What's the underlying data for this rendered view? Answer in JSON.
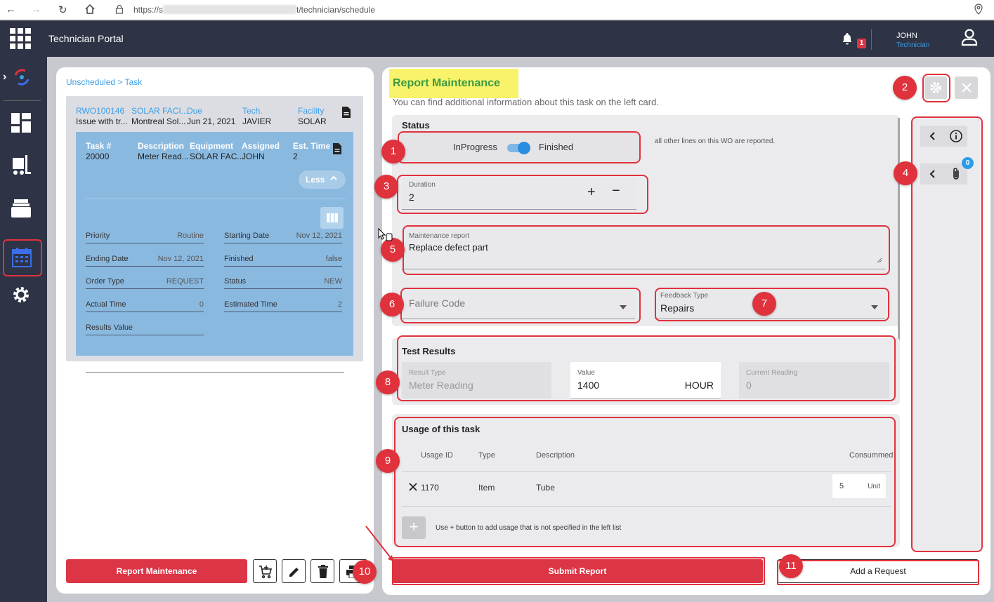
{
  "browser": {
    "url_prefix": "https://s",
    "url_suffix": "t/technician/schedule"
  },
  "app": {
    "title": "Technician Portal",
    "notification_count": "1",
    "user_name": "JOHN",
    "user_role": "Technician"
  },
  "left_card": {
    "breadcrumb": "Unscheduled > Task",
    "wo_headers": [
      "RWO100146",
      "SOLAR FACI...",
      "Due",
      "Tech.",
      "Facility"
    ],
    "wo_values": [
      "Issue with tr...",
      "Montreal Sol...",
      "Jun 21, 2021",
      "JAVIER",
      "SOLAR"
    ],
    "task_headers": [
      "Task #",
      "Description",
      "Equipment",
      "Assigned",
      "Est. Time"
    ],
    "task_values": [
      "20000",
      "Meter Read...",
      "SOLAR FAC...",
      "JOHN",
      "2"
    ],
    "less_label": "Less",
    "details_left": [
      {
        "label": "Priority",
        "value": "Routine"
      },
      {
        "label": "Ending Date",
        "value": "Nov 12, 2021"
      },
      {
        "label": "Order Type",
        "value": "REQUEST"
      },
      {
        "label": "Actual Time",
        "value": "0"
      },
      {
        "label": "Results Value",
        "value": ""
      }
    ],
    "details_right": [
      {
        "label": "Starting Date",
        "value": "Nov 12, 2021"
      },
      {
        "label": "Finished",
        "value": "false"
      },
      {
        "label": "Status",
        "value": "NEW"
      },
      {
        "label": "Estimated Time",
        "value": "2"
      }
    ],
    "report_button": "Report Maintenance"
  },
  "right_card": {
    "title": "Report Maintenance",
    "subtitle": "You can find additional information about this task on the left card.",
    "status_title": "Status",
    "toggle_left": "InProgress",
    "toggle_right": "Finished",
    "status_note": "all other lines on this WO are reported.",
    "duration_label": "Duration",
    "duration_value": "2",
    "maint_report_label": "Maintenance report",
    "maint_report_value": "Replace defect part",
    "failure_code_placeholder": "Failure Code",
    "feedback_type_label": "Feedback Type",
    "feedback_type_value": "Repairs",
    "test_results_title": "Test Results",
    "result_type_label": "Result Type",
    "result_type_value": "Meter Reading",
    "value_label": "Value",
    "value_value": "1400",
    "value_unit": "HOUR",
    "current_reading_label": "Current Reading",
    "current_reading_value": "0",
    "usage_title": "Usage of this task",
    "usage_headers": [
      "Usage ID",
      "Type",
      "Description",
      "Consummed"
    ],
    "usage_row": {
      "id": "1170",
      "type": "Item",
      "description": "Tube",
      "qty": "5",
      "unit": "Unit"
    },
    "usage_hint": "Use + button to add usage that is not specified in the left list",
    "attachment_count": "0",
    "submit_label": "Submit Report",
    "add_request_label": "Add a Request"
  },
  "annotations": [
    "1",
    "2",
    "3",
    "4",
    "5",
    "6",
    "7",
    "8",
    "9",
    "10",
    "11"
  ],
  "colors": {
    "header_bg": "#2e3345",
    "accent_blue": "#3b9ee8",
    "danger": "#dc3545",
    "annotation_red": "#e0323c",
    "task_card": "#8ab9e0",
    "title_highlight": "#f8f36a",
    "title_text": "#3a9a44"
  }
}
